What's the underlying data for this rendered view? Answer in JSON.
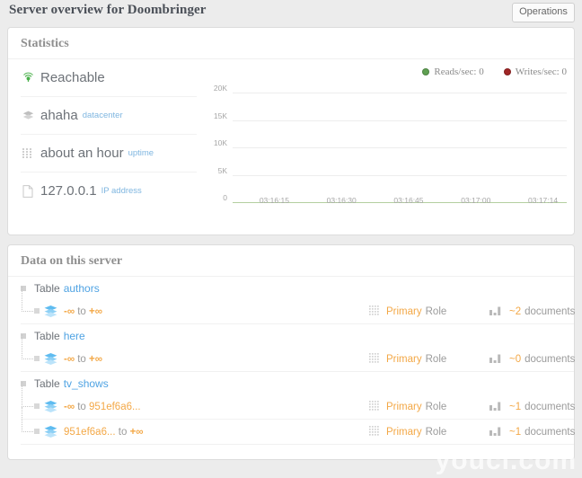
{
  "header": {
    "title": "Server overview for Doombringer",
    "operations_button": "Operations"
  },
  "statistics": {
    "title": "Statistics",
    "rows": [
      {
        "icon": "signal-icon",
        "main": "Reachable",
        "sub": ""
      },
      {
        "icon": "layers-icon",
        "main": "ahaha",
        "sub": "datacenter"
      },
      {
        "icon": "grid-dots-icon",
        "main": "about an hour",
        "sub": "uptime"
      },
      {
        "icon": "document-icon",
        "main": "127.0.0.1",
        "sub": "IP address"
      }
    ]
  },
  "chart_data": {
    "type": "line",
    "title": "",
    "xlabel": "",
    "ylabel": "",
    "x": [
      "03:16:15",
      "03:16:30",
      "03:16:45",
      "03:17:00",
      "03:17:14"
    ],
    "yticks": [
      "0",
      "5K",
      "10K",
      "15K",
      "20K"
    ],
    "ylim": [
      0,
      20000
    ],
    "grid": true,
    "legend_position": "top-right",
    "series": [
      {
        "name": "Reads/sec: 0",
        "color": "#5fa052",
        "values": [
          0,
          0,
          0,
          0,
          0
        ]
      },
      {
        "name": "Writes/sec: 0",
        "color": "#a02626",
        "values": [
          0,
          0,
          0,
          0,
          0
        ]
      }
    ]
  },
  "data_section": {
    "title": "Data on this server",
    "table_word": "Table",
    "tables": [
      {
        "name": "authors",
        "shards": [
          {
            "from": "-∞",
            "to_word": "to",
            "to": "+∞",
            "role_value": "Primary",
            "role_label": "Role",
            "docs_value": "~2",
            "docs_label": "documents"
          }
        ]
      },
      {
        "name": "here",
        "shards": [
          {
            "from": "-∞",
            "to_word": "to",
            "to": "+∞",
            "role_value": "Primary",
            "role_label": "Role",
            "docs_value": "~0",
            "docs_label": "documents"
          }
        ]
      },
      {
        "name": "tv_shows",
        "shards": [
          {
            "from": "-∞",
            "to_word": "to",
            "to": "951ef6a6...",
            "role_value": "Primary",
            "role_label": "Role",
            "docs_value": "~1",
            "docs_label": "documents"
          },
          {
            "from": "951ef6a6...",
            "to_word": "to",
            "to": "+∞",
            "role_value": "Primary",
            "role_label": "Role",
            "docs_value": "~1",
            "docs_label": "documents"
          }
        ]
      }
    ]
  },
  "watermark": "youcl.com"
}
